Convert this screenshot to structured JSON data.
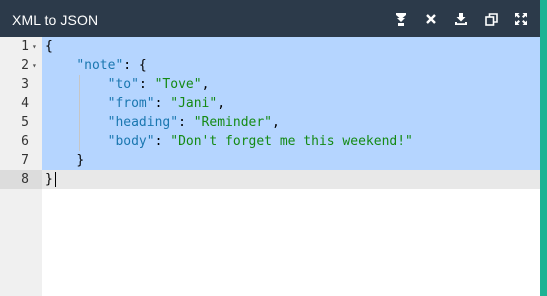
{
  "app": {
    "title": "XML to JSON"
  },
  "toolbar": {
    "buttons": [
      {
        "name": "format-button",
        "icon": "format-icon"
      },
      {
        "name": "clear-button",
        "icon": "close-icon"
      },
      {
        "name": "download-button",
        "icon": "download-icon"
      },
      {
        "name": "copy-button",
        "icon": "copy-icon"
      },
      {
        "name": "fullscreen-button",
        "icon": "expand-icon"
      }
    ]
  },
  "colors": {
    "titlebar": "#2c3a4a",
    "selection": "#b5d5ff",
    "key": "#1a77b0",
    "string": "#148a14",
    "background_accent": "#1db394"
  },
  "editor": {
    "line_numbers": [
      "1",
      "2",
      "3",
      "4",
      "5",
      "6",
      "7",
      "8"
    ],
    "fold_markers": [
      "1",
      "2"
    ],
    "lines": [
      {
        "indent": "",
        "tokens": [
          {
            "t": "pun",
            "v": "{"
          }
        ]
      },
      {
        "indent": "    ",
        "tokens": [
          {
            "t": "key",
            "v": "\"note\""
          },
          {
            "t": "pun",
            "v": ": {"
          }
        ]
      },
      {
        "indent": "        ",
        "tokens": [
          {
            "t": "key",
            "v": "\"to\""
          },
          {
            "t": "pun",
            "v": ": "
          },
          {
            "t": "str",
            "v": "\"Tove\""
          },
          {
            "t": "pun",
            "v": ","
          }
        ]
      },
      {
        "indent": "        ",
        "tokens": [
          {
            "t": "key",
            "v": "\"from\""
          },
          {
            "t": "pun",
            "v": ": "
          },
          {
            "t": "str",
            "v": "\"Jani\""
          },
          {
            "t": "pun",
            "v": ","
          }
        ]
      },
      {
        "indent": "        ",
        "tokens": [
          {
            "t": "key",
            "v": "\"heading\""
          },
          {
            "t": "pun",
            "v": ": "
          },
          {
            "t": "str",
            "v": "\"Reminder\""
          },
          {
            "t": "pun",
            "v": ","
          }
        ]
      },
      {
        "indent": "        ",
        "tokens": [
          {
            "t": "key",
            "v": "\"body\""
          },
          {
            "t": "pun",
            "v": ": "
          },
          {
            "t": "str",
            "v": "\"Don't forget me this weekend!\""
          }
        ]
      },
      {
        "indent": "    ",
        "tokens": [
          {
            "t": "pun",
            "v": "}"
          }
        ]
      },
      {
        "indent": "",
        "tokens": [
          {
            "t": "pun",
            "v": "}"
          }
        ]
      }
    ],
    "active_line": 8
  }
}
